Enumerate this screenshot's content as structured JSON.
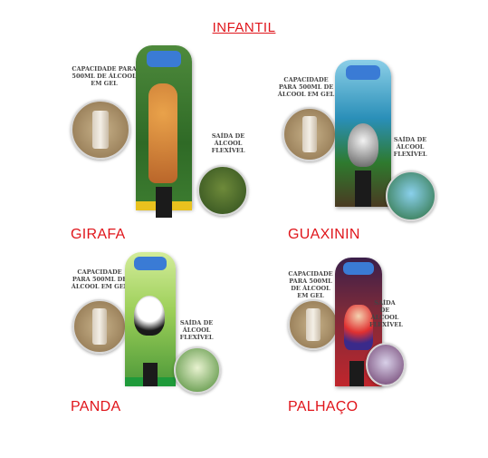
{
  "page": {
    "title": "INFANTIL"
  },
  "products": [
    {
      "id": "girafa",
      "label": "GIRAFA",
      "capacity_text": "CAPACIDADE PARA 500ML DE ÁLCOOL EM GEL",
      "outlet_text": "SAÍDA DE ÁLCOOL FLEXÍVEL",
      "panel_color": "#2f7a2a",
      "base_color": "#e9c21e"
    },
    {
      "id": "guaxinin",
      "label": "GUAXININ",
      "capacity_text": "CAPACIDADE PARA 500ML DE ÁLCOOL EM GEL",
      "outlet_text": "SAÍDA DE ÁLCOOL FLEXÍVEL",
      "panel_color": "#2a8fb8",
      "base_color": "#2a8fb8"
    },
    {
      "id": "panda",
      "label": "PANDA",
      "capacity_text": "CAPACIDADE PARA 500ML DE ÁLCOOL EM GEL",
      "outlet_text": "SAÍDA DE ÁLCOOL FLEXÍVEL",
      "panel_color": "#a6d25a",
      "base_color": "#1f9a3a"
    },
    {
      "id": "palhaco",
      "label": "PALHAÇO",
      "capacity_text": "CAPACIDADE PARA 500ML DE ÁLCOOL EM GEL",
      "outlet_text": "SAÍDA DE ÁLCOOL FLEXÍVEL",
      "panel_color": "#c0262c",
      "base_color": "#c0262c"
    }
  ]
}
